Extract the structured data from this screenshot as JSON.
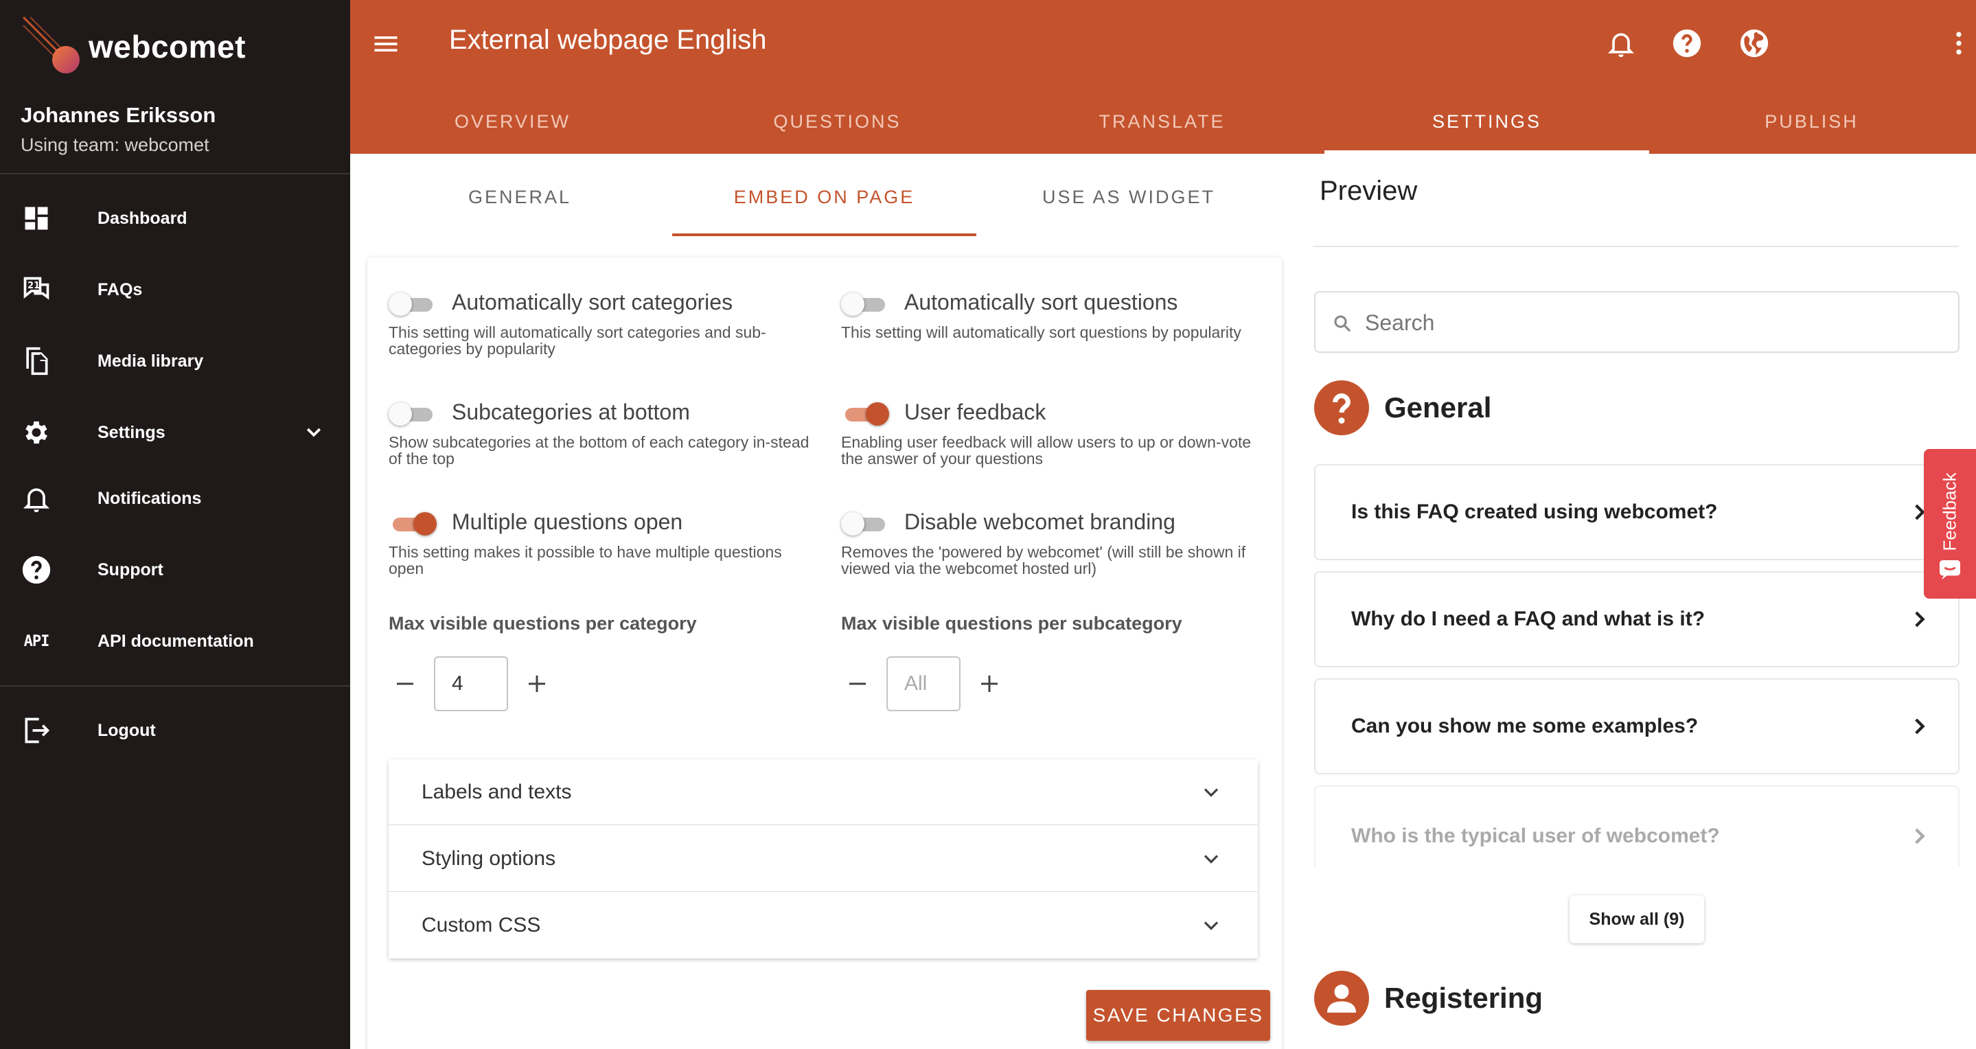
{
  "brand": {
    "name": "webcomet"
  },
  "user": {
    "name": "Johannes Eriksson",
    "team": "Using team: webcomet"
  },
  "nav": [
    {
      "id": "dashboard",
      "label": "Dashboard",
      "icon": "dashboard-icon"
    },
    {
      "id": "faqs",
      "label": "FAQs",
      "icon": "faq-icon"
    },
    {
      "id": "media-library",
      "label": "Media library",
      "icon": "file-icon"
    },
    {
      "id": "settings",
      "label": "Settings",
      "icon": "gear-icon"
    },
    {
      "id": "notifications",
      "label": "Notifications",
      "icon": "bell-icon"
    },
    {
      "id": "support",
      "label": "Support",
      "icon": "help-icon"
    },
    {
      "id": "api",
      "label": "API documentation",
      "icon": "api-icon",
      "glyph": "API"
    },
    {
      "id": "logout",
      "label": "Logout",
      "icon": "logout-icon"
    }
  ],
  "header": {
    "title": "External webpage English",
    "tabs": [
      "OVERVIEW",
      "QUESTIONS",
      "TRANSLATE",
      "SETTINGS",
      "PUBLISH"
    ],
    "active_tab": "SETTINGS"
  },
  "subtabs": {
    "items": [
      "GENERAL",
      "EMBED ON PAGE",
      "USE AS WIDGET"
    ],
    "active": "EMBED ON PAGE"
  },
  "settings": [
    {
      "title": "Automatically sort categories",
      "desc": "This setting will automatically sort categories and sub-categories by popularity",
      "on": false
    },
    {
      "title": "Automatically sort questions",
      "desc": "This setting will automatically sort questions by popularity",
      "on": false
    },
    {
      "title": "Subcategories at bottom",
      "desc": "Show subcategories at the bottom of each category in-stead of the top",
      "on": false
    },
    {
      "title": "User feedback",
      "desc": "Enabling user feedback will allow users to up or down-vote the answer of your questions",
      "on": true
    },
    {
      "title": "Multiple questions open",
      "desc": "This setting makes it possible to have multiple questions open",
      "on": true
    },
    {
      "title": "Disable webcomet branding",
      "desc": "Removes the 'powered by webcomet' (will still be shown if viewed via the webcomet hosted url)",
      "on": false
    }
  ],
  "steppers": {
    "per_category": {
      "label": "Max visible questions per category",
      "value": "4",
      "placeholder": ""
    },
    "per_subcategory": {
      "label": "Max visible questions per subcategory",
      "value": "",
      "placeholder": "All"
    }
  },
  "accordion": [
    "Labels and texts",
    "Styling options",
    "Custom CSS"
  ],
  "save_label": "SAVE CHANGES",
  "preview": {
    "title": "Preview",
    "search_placeholder": "Search",
    "categories": [
      {
        "title": "General",
        "questions": [
          "Is this FAQ created using webcomet?",
          "Why do I need a FAQ and what is it?",
          "Can you show me some examples?",
          "Who is the typical user of webcomet?"
        ],
        "show_all": "Show all (9)"
      },
      {
        "title": "Registering"
      }
    ]
  },
  "feedback_label": "Feedback",
  "colors": {
    "accent": "#c4532d",
    "sidebar": "#1f1a19",
    "feedback": "#e5484d"
  }
}
